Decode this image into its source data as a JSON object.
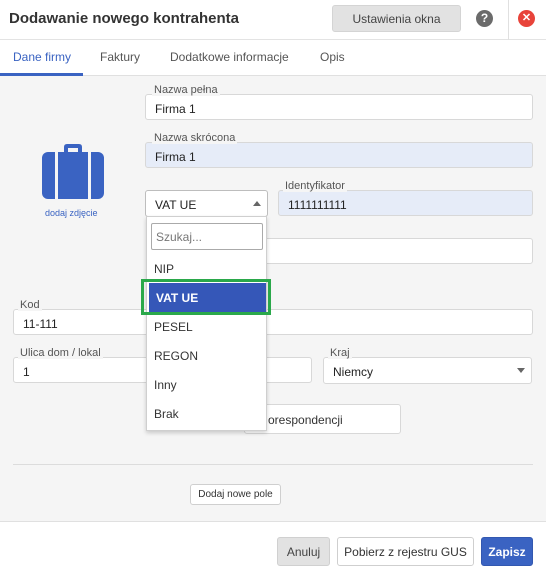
{
  "window": {
    "title": "Dodawanie nowego kontrahenta",
    "settings_button": "Ustawienia okna",
    "help_icon": "question-circle-icon",
    "close_icon": "close-circle-icon",
    "help_glyph": "?",
    "close_glyph": "✕"
  },
  "tabs": [
    "Dane firmy",
    "Faktury",
    "Dodatkowe informacje",
    "Opis"
  ],
  "photo": {
    "icon": "suitcase-icon",
    "link": "dodaj zdjęcie",
    "icon_color": "#3a63c2"
  },
  "form": {
    "full_name": {
      "label": "Nazwa pełna",
      "value": "Firma 1"
    },
    "short_name": {
      "label": "Nazwa skrócona",
      "value": "Firma 1"
    },
    "id_type": {
      "value": "VAT UE"
    },
    "identifier": {
      "label": "Identyfikator",
      "value": "1111111111"
    },
    "postal_code": {
      "label": "Kod",
      "value": "11-111"
    },
    "street": {
      "label": "Ulica dom / lokal",
      "value": "1"
    },
    "country": {
      "label": "Kraj",
      "value": "Niemcy"
    },
    "correspondence_button": "orespondencji",
    "add_field_button": "Dodaj nowe pole"
  },
  "dropdown": {
    "search_placeholder": "Szukaj...",
    "options": [
      "NIP",
      "VAT UE",
      "PESEL",
      "REGON",
      "Inny",
      "Brak"
    ],
    "selected": "VAT UE"
  },
  "footer": {
    "cancel": "Anuluj",
    "gus": "Pobierz z rejestru GUS",
    "save": "Zapisz"
  },
  "colors": {
    "accent": "#3a63c2",
    "selected_option": "#3557b8",
    "highlight_border": "#2aa84a",
    "close": "#e8433a"
  }
}
